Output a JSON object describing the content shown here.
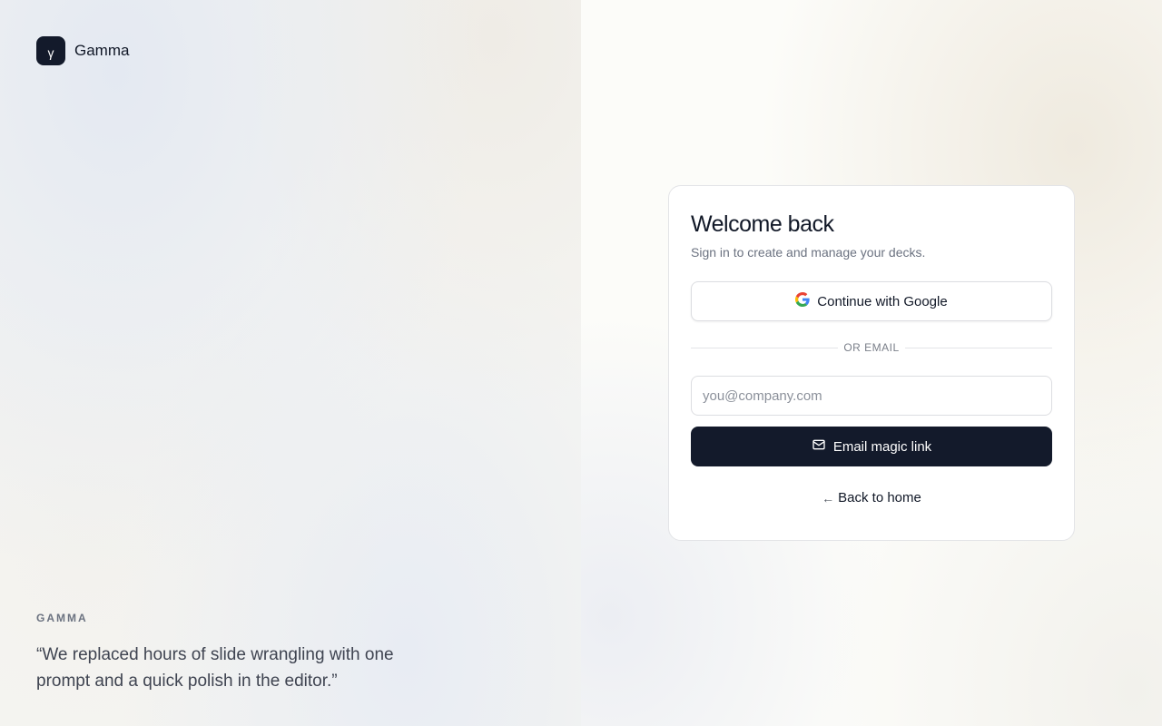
{
  "brand": {
    "mark": "γ",
    "name": "Gamma"
  },
  "quote": {
    "kicker": "GAMMA",
    "text": "“We replaced hours of slide wrangling with one prompt and a quick polish in the editor.”"
  },
  "card": {
    "title": "Welcome back",
    "subtitle": "Sign in to create and manage your decks.",
    "google_label": "Continue with Google",
    "divider_label": "OR EMAIL",
    "email_placeholder": "you@company.com",
    "email_value": "",
    "magic_link_label": "Email magic link",
    "back_label": "Back to home",
    "back_arrow": "←"
  },
  "icons": {
    "google": "google-g-icon",
    "mail": "mail-icon"
  },
  "colors": {
    "primary": "#131a2b",
    "border": "#dcdde1",
    "muted_text": "#6b7280"
  }
}
